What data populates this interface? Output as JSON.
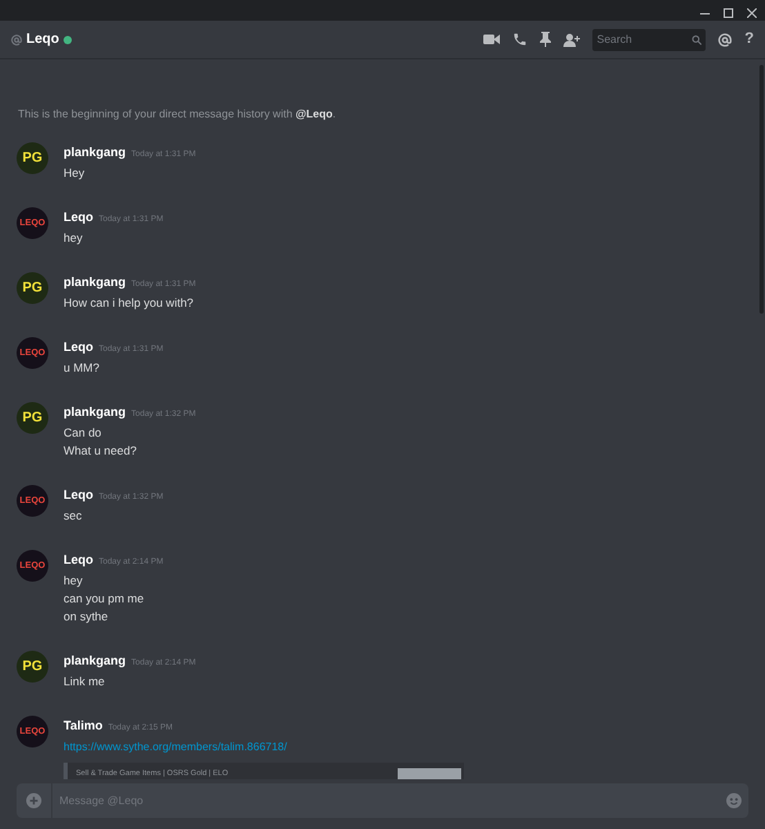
{
  "header": {
    "name": "Leqo",
    "online": true,
    "help": "?",
    "search": {
      "placeholder": "Search"
    }
  },
  "intro": "This is the beginning of your direct message history with **@Leqo**.",
  "messages": [
    {
      "author": "plankgang",
      "avatar": {
        "kind": "pg",
        "text": "PG"
      },
      "time": "Today at 1:31 PM",
      "lines": [
        "Hey"
      ]
    },
    {
      "author": "Leqo",
      "avatar": {
        "kind": "leqo",
        "text": "LEQO"
      },
      "time": "Today at 1:31 PM",
      "lines": [
        "hey"
      ]
    },
    {
      "author": "plankgang",
      "avatar": {
        "kind": "pg",
        "text": "PG"
      },
      "time": "Today at 1:31 PM",
      "lines": [
        "How can i help you with?"
      ]
    },
    {
      "author": "Leqo",
      "avatar": {
        "kind": "leqo",
        "text": "LEQO"
      },
      "time": "Today at 1:31 PM",
      "lines": [
        "u MM?"
      ]
    },
    {
      "author": "plankgang",
      "avatar": {
        "kind": "pg",
        "text": "PG"
      },
      "time": "Today at 1:32 PM",
      "lines": [
        "Can do",
        "What u need?"
      ]
    },
    {
      "author": "Leqo",
      "avatar": {
        "kind": "leqo",
        "text": "LEQO"
      },
      "time": "Today at 1:32 PM",
      "lines": [
        "sec"
      ]
    },
    {
      "author": "Leqo",
      "avatar": {
        "kind": "leqo",
        "text": "LEQO"
      },
      "time": "Today at 2:14 PM",
      "lines": [
        "hey",
        "can you pm me",
        "on sythe"
      ]
    },
    {
      "author": "plankgang",
      "avatar": {
        "kind": "pg",
        "text": "PG"
      },
      "time": "Today at 2:14 PM",
      "lines": [
        "Link me"
      ]
    },
    {
      "author": "Talimo",
      "avatar": {
        "kind": "leqo",
        "text": "LEQO"
      },
      "time": "Today at 2:15 PM",
      "link": "https://www.sythe.org/members/talim.866718/",
      "embed": {
        "title": "Sell & Trade Game Items | OSRS Gold | ELO"
      }
    }
  ],
  "composer": {
    "placeholder": "Message @Leqo"
  }
}
